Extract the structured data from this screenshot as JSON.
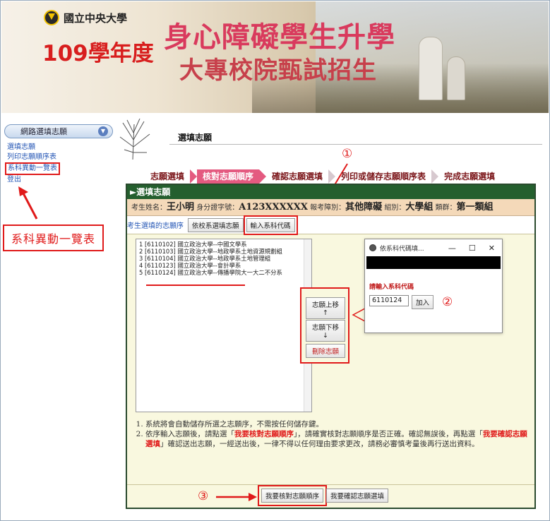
{
  "banner": {
    "school": "國立中央大學",
    "year": "109學年度",
    "title_line1": "身心障礙學生升學",
    "title_line2": "大專校院甄試招生"
  },
  "sidebar": {
    "head": "網路選填志願",
    "items": [
      "選填志願",
      "列印志願順序表",
      "系科異動一覽表",
      "登出"
    ]
  },
  "annotations": {
    "callout_label": "系科異動一覽表",
    "mark1": "①",
    "mark2": "②",
    "mark3": "③"
  },
  "page": {
    "title": "選填志願"
  },
  "steps": [
    "志願選填",
    "核對志願順序",
    "確認志願選填",
    "列印或儲存志願順序表",
    "完成志願選填"
  ],
  "panel": {
    "head": "►選填志願",
    "info": {
      "name_label": "考生姓名：",
      "name": "王小明",
      "id_label": "身分證字號：",
      "id": "A123XXXXXX",
      "category_label": "報考障別：",
      "category": "其他障礙",
      "group_label": "組別：",
      "group": "大學組",
      "cluster_label": "類群：",
      "cluster": "第一類組"
    },
    "order_label": "考生選填的志願序",
    "btn_sort": "依校系選填志願",
    "btn_code": "輸入系科代碼",
    "choices": [
      "1 [6110102]  國立政治大學--中國文學系",
      "2 [6110103]  國立政治大學--地政學系土地資源規劃組",
      "3 [6110104]  國立政治大學--地政學系土地管理組",
      "4 [6110123]  國立政治大學--會計學系",
      "5 [6110124]  國立政治大學--傳播學院大一大二不分系"
    ],
    "btn_up": "志願上移↑",
    "btn_down": "志願下移↓",
    "btn_delete": "刪除志願",
    "notes": {
      "n1": "系統將會自動儲存所選之志願序，不需按任何儲存鍵。",
      "n2a": "依序輸入志願後，請點選「",
      "n2b": "我要核對志願順序",
      "n2c": "」，請確實核對志願順序是否正確。確認無誤後，再點選「",
      "n2d": "我要確認志願選填",
      "n2e": "」確認送出志願，一經送出後，一律不得以任何理由要求更改，請務必審慎考量後再行送出資料。"
    },
    "btn_verify": "我要核對志願順序",
    "btn_confirm": "我要確認志願選填"
  },
  "popup": {
    "title": "依系科代碼填...",
    "ctrl_min": "—",
    "ctrl_max": "☐",
    "ctrl_close": "✕",
    "label": "請輸入系科代碼",
    "value": "6110124",
    "btn_add": "加入"
  }
}
